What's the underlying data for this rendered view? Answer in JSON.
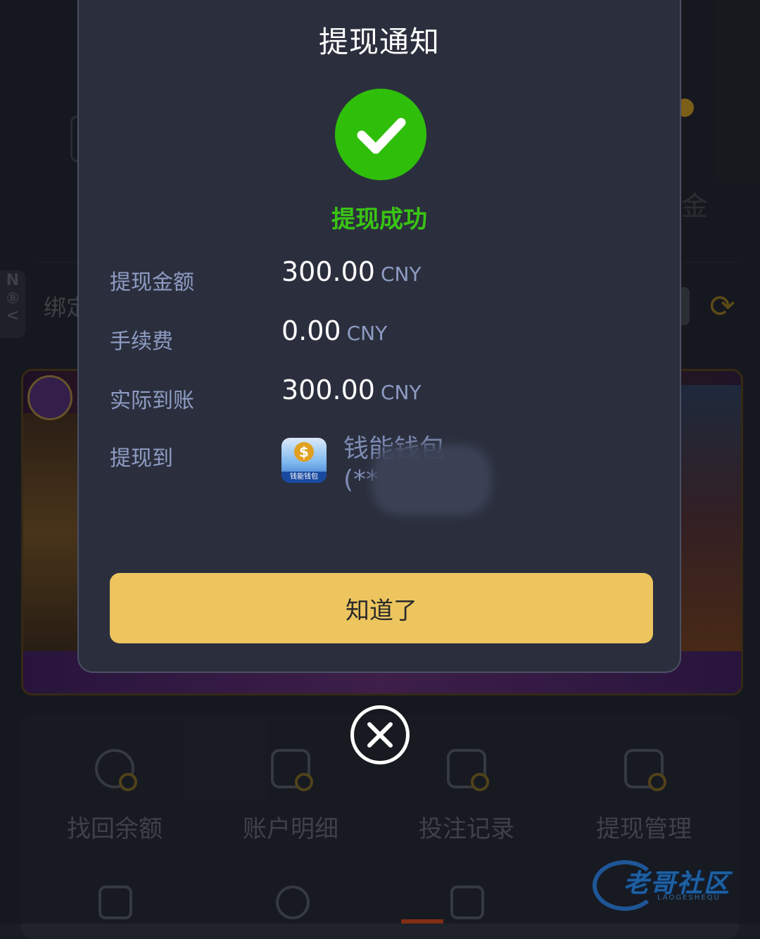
{
  "background": {
    "bind_label_partial": "绑定",
    "side_tab_letter": "N",
    "side_tab_chevron": "<",
    "refresh_icon": "refresh-icon",
    "right_partial_char": "金",
    "menu_row1": [
      {
        "label": "找回余额",
        "icon": "coin-search-icon"
      },
      {
        "label": "账户明细",
        "icon": "account-detail-icon"
      },
      {
        "label": "投注记录",
        "icon": "bet-record-icon"
      },
      {
        "label": "提现管理",
        "icon": "withdraw-manage-icon"
      }
    ],
    "watermark": {
      "text": "老哥社区",
      "sub": "LAOGESHEQU"
    }
  },
  "modal": {
    "title": "提现通知",
    "status_text": "提现成功",
    "status_color": "#39c414",
    "rows": {
      "amount": {
        "label": "提现金额",
        "value": "300.00",
        "unit": "CNY"
      },
      "fee": {
        "label": "手续费",
        "value": "0.00",
        "unit": "CNY"
      },
      "actual": {
        "label": "实际到账",
        "value": "300.00",
        "unit": "CNY"
      },
      "destination": {
        "label": "提现到",
        "wallet_name": "钱能钱包",
        "account_prefix": "(**",
        "logo_caption": "钱能钱包",
        "logo_symbol": "$"
      }
    },
    "confirm_label": "知道了",
    "accent_color": "#ecc55f"
  },
  "close_icon": "close-circle-icon"
}
